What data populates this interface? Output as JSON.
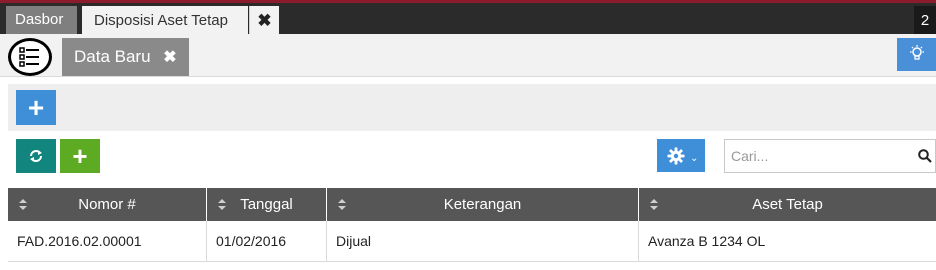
{
  "topbar": {
    "tabs": [
      {
        "label": "Dasbor"
      },
      {
        "label": "Disposisi Aset Tetap"
      }
    ],
    "close_label": "✖",
    "corner_label": "2"
  },
  "subbar": {
    "data_tab_label": "Data Baru",
    "data_tab_close": "✖"
  },
  "toolbar": {
    "add_label": "+",
    "add_green_label": "+"
  },
  "search": {
    "placeholder": "Cari..."
  },
  "table": {
    "columns": [
      "Nomor #",
      "Tanggal",
      "Keterangan",
      "Aset Tetap"
    ],
    "rows": [
      [
        "FAD.2016.02.00001",
        "01/02/2016",
        "Dijual",
        "Avanza B 1234 OL"
      ]
    ]
  },
  "colors": {
    "accent_blue": "#3f8fd8",
    "teal": "#12857e",
    "green": "#5cab23",
    "header_gray": "#565656",
    "topbar_dark": "#2b2b2b"
  },
  "icons": [
    "list-menu-icon",
    "lightbulb-icon",
    "refresh-icon",
    "gear-icon",
    "search-icon",
    "sort-icon"
  ]
}
